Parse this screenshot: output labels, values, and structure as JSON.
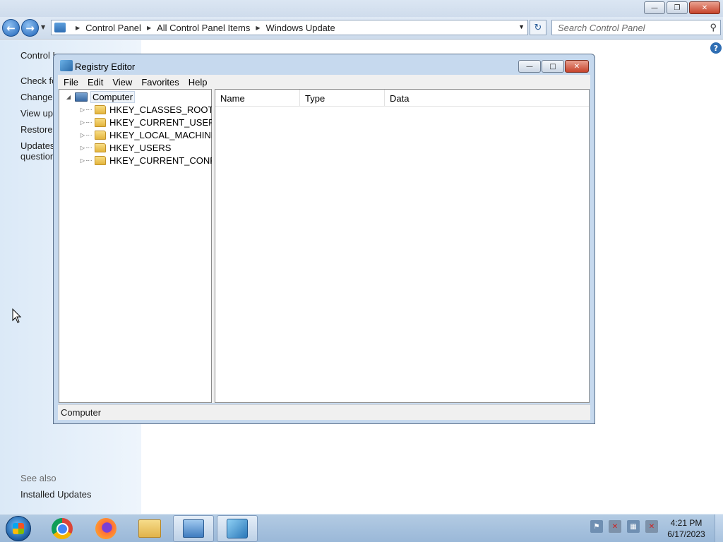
{
  "control_panel": {
    "address_crumbs": [
      "Control Panel",
      "All Control Panel Items",
      "Windows Update"
    ],
    "search_placeholder": "Search Control Panel",
    "left_links": {
      "home": "Control Panel Home",
      "check": "Check for updates",
      "change": "Change settings",
      "view": "View update history",
      "restore": "Restore hidden updates",
      "faq_1": "Updates: frequently asked",
      "faq_2": "questions"
    },
    "see_also": "See also",
    "installed_updates": "Installed Updates"
  },
  "regedit": {
    "title": "Registry Editor",
    "menu": [
      "File",
      "Edit",
      "View",
      "Favorites",
      "Help"
    ],
    "tree_root": "Computer",
    "hives": [
      "HKEY_CLASSES_ROOT",
      "HKEY_CURRENT_USER",
      "HKEY_LOCAL_MACHINE",
      "HKEY_USERS",
      "HKEY_CURRENT_CONFIG"
    ],
    "columns": [
      "Name",
      "Type",
      "Data"
    ],
    "status": "Computer"
  },
  "taskbar": {
    "time": "4:21 PM",
    "date": "6/17/2023"
  },
  "icons": {
    "start": "windows-start-orb",
    "chrome": "chrome-icon",
    "firefox": "firefox-icon",
    "explorer": "folder-icon",
    "control_panel": "control-panel-icon",
    "regedit": "registry-editor-icon"
  }
}
